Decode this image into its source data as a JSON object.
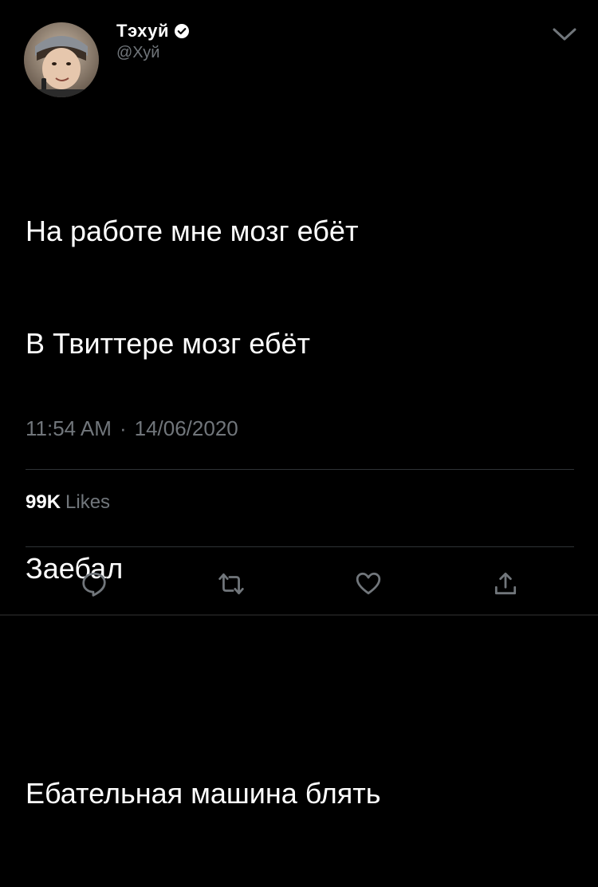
{
  "author": {
    "display_name": "Тэхуй",
    "handle": "@Хуй",
    "verified_icon": "verified-badge-icon",
    "avatar_icon": "avatar-photo"
  },
  "header": {
    "menu_icon": "chevron-down-icon"
  },
  "tweet": {
    "lines": [
      "На работе мне мозг ебёт",
      "В Твиттере мозг ебёт",
      "",
      "Заебал",
      "",
      "Ебательная машина блять"
    ],
    "time": "11:54 AM",
    "separator": "·",
    "date": "14/06/2020"
  },
  "stats": {
    "likes_count": "99K",
    "likes_label": "Likes"
  },
  "actions": {
    "reply_icon": "reply-icon",
    "retweet_icon": "retweet-icon",
    "like_icon": "heart-icon",
    "share_icon": "share-icon"
  },
  "colors": {
    "background": "#000000",
    "text": "#ffffff",
    "secondary": "#71767b",
    "divider": "#2f3336"
  }
}
